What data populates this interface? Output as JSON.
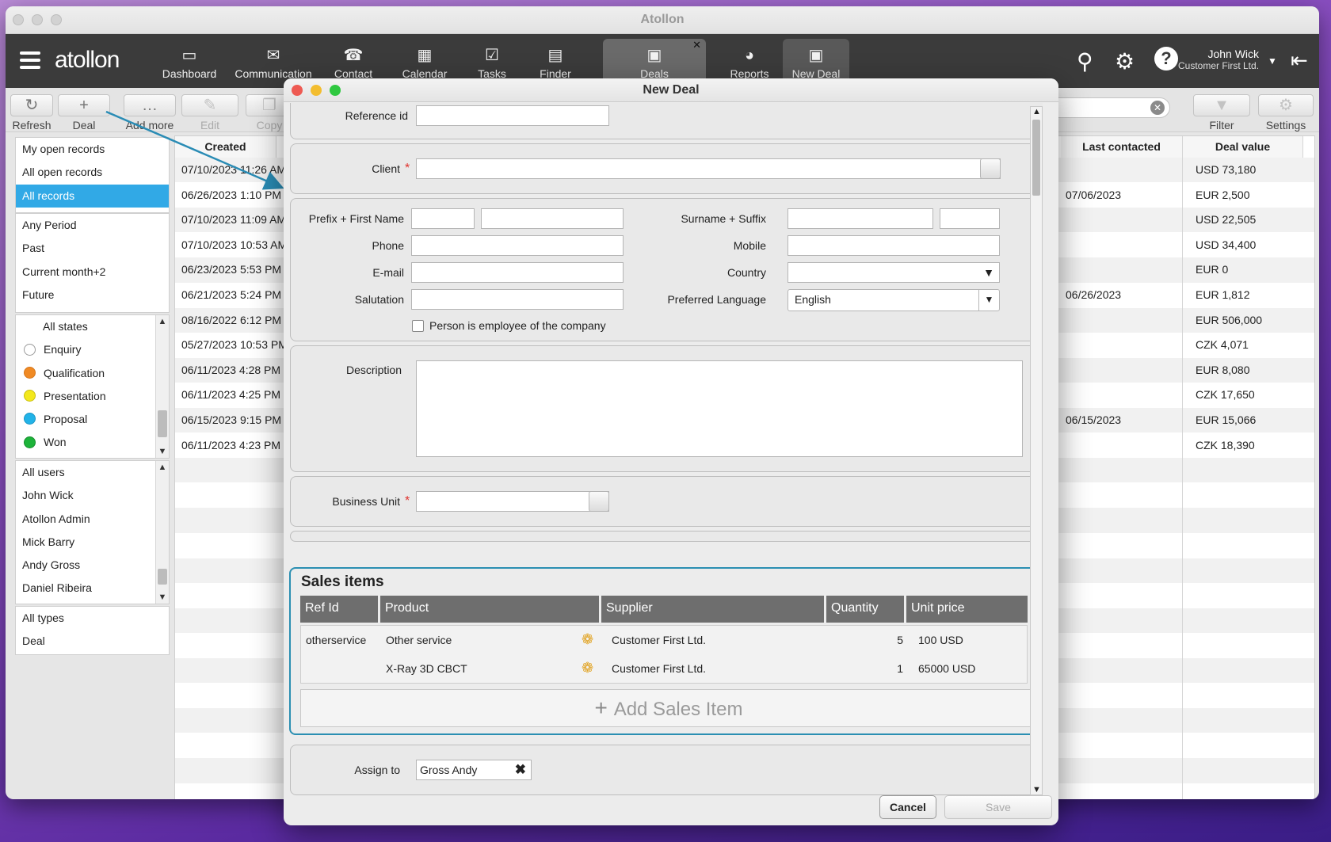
{
  "window": {
    "title": "Atollon"
  },
  "nav": {
    "logo": "atollon",
    "items": [
      {
        "label": "Dashboard",
        "icon": "▭"
      },
      {
        "label": "Communication",
        "icon": "✉"
      },
      {
        "label": "Contact",
        "icon": "☎"
      },
      {
        "label": "Calendar",
        "icon": "▦"
      },
      {
        "label": "Tasks",
        "icon": "☑"
      },
      {
        "label": "Finder",
        "icon": "▤"
      },
      {
        "label": "Deals",
        "icon": "▣"
      },
      {
        "label": "Reports",
        "icon": "◕"
      },
      {
        "label": "New Deal",
        "icon": "▣"
      }
    ],
    "close_tab": "✕",
    "user_name": "John Wick",
    "user_company": "Customer First Ltd."
  },
  "toolbar": {
    "refresh": "Refresh",
    "deal": "Deal",
    "add_more": "Add more",
    "edit": "Edit",
    "copy": "Copy",
    "filter": "Filter",
    "settings": "Settings"
  },
  "sidebar": {
    "records": [
      "My open records",
      "All open records",
      "All records"
    ],
    "periods": [
      "Any Period",
      "Past",
      "Current month+2",
      "Future"
    ],
    "states": [
      {
        "label": "All states",
        "color": ""
      },
      {
        "label": "Enquiry",
        "color": "#ffffff"
      },
      {
        "label": "Qualification",
        "color": "#f08a24"
      },
      {
        "label": "Presentation",
        "color": "#f3e81c"
      },
      {
        "label": "Proposal",
        "color": "#22b3e8"
      },
      {
        "label": "Won",
        "color": "#1db33a"
      }
    ],
    "users": [
      "All users",
      "John Wick",
      "Atollon Admin",
      "Mick Barry",
      "Andy Gross",
      "Daniel Ribeira"
    ],
    "types": [
      "All types",
      "Deal"
    ]
  },
  "grid": {
    "headers": {
      "created": "Created",
      "last_contacted": "Last contacted",
      "deal_value": "Deal value"
    },
    "rows": [
      {
        "created": "07/10/2023 11:26 AM",
        "last": "",
        "value": "USD 73,180"
      },
      {
        "created": "06/26/2023 1:10 PM",
        "last": "07/06/2023",
        "value": "EUR 2,500"
      },
      {
        "created": "07/10/2023 11:09 AM",
        "last": "",
        "value": "USD 22,505"
      },
      {
        "created": "07/10/2023 10:53 AM",
        "last": "",
        "value": "USD 34,400"
      },
      {
        "created": "06/23/2023 5:53 PM",
        "last": "",
        "value": "EUR 0"
      },
      {
        "created": "06/21/2023 5:24 PM",
        "last": "06/26/2023",
        "value": "EUR 1,812"
      },
      {
        "created": "08/16/2022 6:12 PM",
        "last": "",
        "value": "EUR 506,000"
      },
      {
        "created": "05/27/2023 10:53 PM",
        "last": "",
        "value": "CZK 4,071"
      },
      {
        "created": "06/11/2023 4:28 PM",
        "last": "",
        "value": "EUR 8,080"
      },
      {
        "created": "06/11/2023 4:25 PM",
        "last": "",
        "value": "CZK 17,650"
      },
      {
        "created": "06/15/2023 9:15 PM",
        "last": "06/15/2023",
        "value": "EUR 15,066"
      },
      {
        "created": "06/11/2023 4:23 PM",
        "last": "",
        "value": "CZK 18,390"
      }
    ]
  },
  "dialog": {
    "title": "New Deal",
    "reference_id": {
      "label": "Reference id",
      "value": ""
    },
    "client": {
      "label": "Client",
      "value": ""
    },
    "prefix_first": {
      "label": "Prefix + First Name"
    },
    "surname_suffix": {
      "label": "Surname + Suffix"
    },
    "phone": {
      "label": "Phone"
    },
    "mobile": {
      "label": "Mobile"
    },
    "email": {
      "label": "E-mail"
    },
    "country": {
      "label": "Country",
      "value": ""
    },
    "salutation": {
      "label": "Salutation"
    },
    "language": {
      "label": "Preferred Language",
      "value": "English"
    },
    "employee_check": {
      "label": "Person is employee of the company"
    },
    "description": {
      "label": "Description"
    },
    "business_unit": {
      "label": "Business Unit",
      "value": ""
    },
    "sales": {
      "title": "Sales items",
      "columns": [
        "Ref Id",
        "Product",
        "Supplier",
        "Quantity",
        "Unit price"
      ],
      "rows": [
        {
          "ref": "otherservice",
          "product": "Other service",
          "supplier": "Customer First Ltd.",
          "qty": "5",
          "price": "100 USD"
        },
        {
          "ref": "",
          "product": "X-Ray 3D CBCT",
          "supplier": "Customer First Ltd.",
          "qty": "1",
          "price": "65000 USD"
        }
      ],
      "add_label": "Add Sales Item"
    },
    "assign": {
      "label": "Assign to",
      "value": "Gross  Andy"
    },
    "cancel": "Cancel",
    "save": "Save"
  }
}
